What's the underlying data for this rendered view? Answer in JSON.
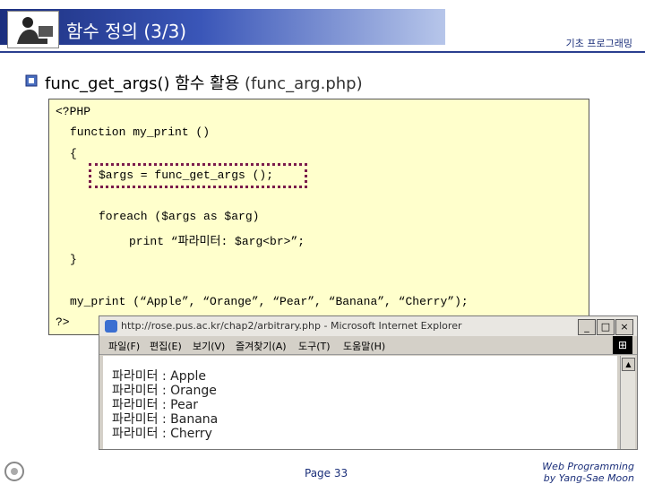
{
  "header": {
    "title": "함수 정의 (3/3)",
    "course": "기초 프로그래밍"
  },
  "section": {
    "heading": "func_get_args() 함수 활용",
    "file": "(func_arg.php)"
  },
  "code": {
    "lines": [
      "<?PHP",
      "function my_print ()",
      "{",
      "$args = func_get_args ();",
      "foreach ($args as $arg)",
      "print “파라미터: $arg<br>”;",
      "}",
      "my_print (“Apple”, “Orange”, “Pear”, “Banana”, “Cherry”);",
      "?>"
    ]
  },
  "browser": {
    "title": "http://rose.pus.ac.kr/chap2/arbitrary.php - Microsoft Internet Explorer",
    "menu": [
      "파일(F)",
      "편집(E)",
      "보기(V)",
      "즐겨찾기(A)",
      "도구(T)",
      "도움말(H)"
    ],
    "output": [
      "파라미터 : Apple",
      "파라미터 : Orange",
      "파라미터 : Pear",
      "파라미터 : Banana",
      "파라미터 : Cherry"
    ]
  },
  "footer": {
    "page": "Page 33",
    "line1": "Web Programming",
    "line2": "by Yang-Sae Moon"
  },
  "colors": {
    "title_bar": "#1c2f7e",
    "code_background": "#ffffcc",
    "highlight_border": "#7a1b4a"
  }
}
